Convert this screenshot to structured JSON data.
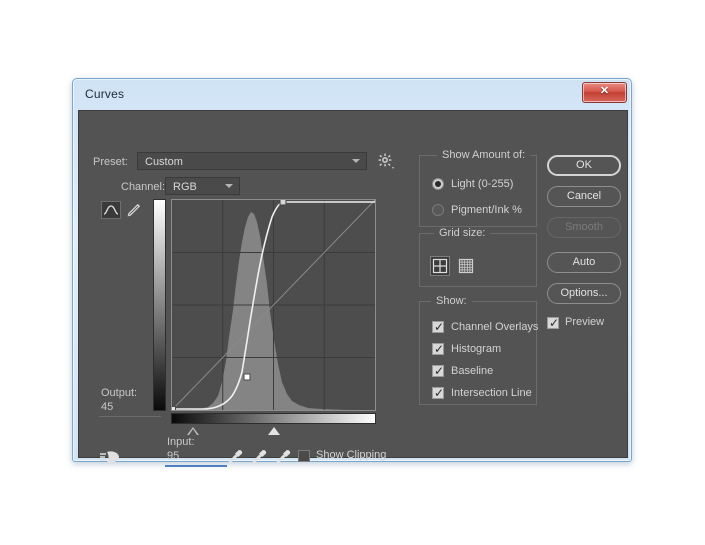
{
  "window": {
    "title": "Curves",
    "close_label": "✕"
  },
  "preset": {
    "label": "Preset:",
    "value": "Custom",
    "menu_icon": "gear-icon"
  },
  "channel": {
    "label": "Channel:",
    "value": "RGB"
  },
  "tools": {
    "curve_icon": "curve-tool-icon",
    "pencil_icon": "pencil-tool-icon",
    "smudge_icon": "smudge-icon",
    "eyedropper_black": "eyedropper-black-point-icon",
    "eyedropper_gray": "eyedropper-gray-point-icon",
    "eyedropper_white": "eyedropper-white-point-icon"
  },
  "readout": {
    "output_label": "Output:",
    "output_value": "45",
    "input_label": "Input:",
    "input_value": "95"
  },
  "show_clipping": {
    "label": "Show Clipping",
    "checked": false
  },
  "show_amount": {
    "title": "Show Amount of:",
    "options": [
      {
        "label": "Light  (0-255)",
        "selected": true
      },
      {
        "label": "Pigment/Ink %",
        "selected": false
      }
    ]
  },
  "grid_size": {
    "title": "Grid size:",
    "options": [
      {
        "name": "coarse-grid",
        "divisions": 4,
        "selected": true
      },
      {
        "name": "fine-grid",
        "divisions": 10,
        "selected": false
      }
    ]
  },
  "show": {
    "title": "Show:",
    "items": [
      {
        "label": "Channel Overlays",
        "checked": true
      },
      {
        "label": "Histogram",
        "checked": true
      },
      {
        "label": "Baseline",
        "checked": true
      },
      {
        "label": "Intersection Line",
        "checked": true
      }
    ]
  },
  "buttons": {
    "ok": "OK",
    "cancel": "Cancel",
    "smooth": "Smooth",
    "auto": "Auto",
    "options": "Options..."
  },
  "preview": {
    "label": "Preview",
    "checked": true
  },
  "chart_data": {
    "type": "line",
    "title": "Curves",
    "xlabel": "Input",
    "ylabel": "Output",
    "xlim": [
      0,
      255
    ],
    "ylim": [
      0,
      255
    ],
    "grid": true,
    "grid_divisions": 4,
    "baseline": {
      "from": [
        0,
        0
      ],
      "to": [
        255,
        255
      ]
    },
    "series": [
      {
        "name": "RGB curve",
        "control_points": [
          {
            "input": 0,
            "output": 0
          },
          {
            "input": 95,
            "output": 45
          },
          {
            "input": 140,
            "output": 255
          }
        ],
        "path_points": [
          [
            0,
            0
          ],
          [
            40,
            0
          ],
          [
            70,
            4
          ],
          [
            85,
            20
          ],
          [
            95,
            45
          ],
          [
            105,
            95
          ],
          [
            115,
            150
          ],
          [
            125,
            205
          ],
          [
            135,
            245
          ],
          [
            140,
            255
          ],
          [
            255,
            255
          ]
        ]
      },
      {
        "name": "Histogram",
        "type": "area",
        "x": [
          0,
          20,
          35,
          45,
          52,
          58,
          63,
          68,
          72,
          76,
          80,
          84,
          88,
          92,
          96,
          100,
          104,
          108,
          112,
          116,
          122,
          130,
          140,
          155,
          175,
          200,
          255
        ],
        "values": [
          0,
          0,
          1,
          3,
          8,
          18,
          36,
          62,
          92,
          126,
          160,
          192,
          219,
          238,
          250,
          244,
          222,
          190,
          152,
          112,
          68,
          34,
          14,
          5,
          2,
          1,
          0
        ]
      }
    ],
    "sliders": {
      "black_point": 40,
      "white_point": 143
    },
    "gradient_bar_x": [
      "black",
      "white"
    ],
    "gradient_bar_y": [
      "white",
      "black"
    ]
  }
}
